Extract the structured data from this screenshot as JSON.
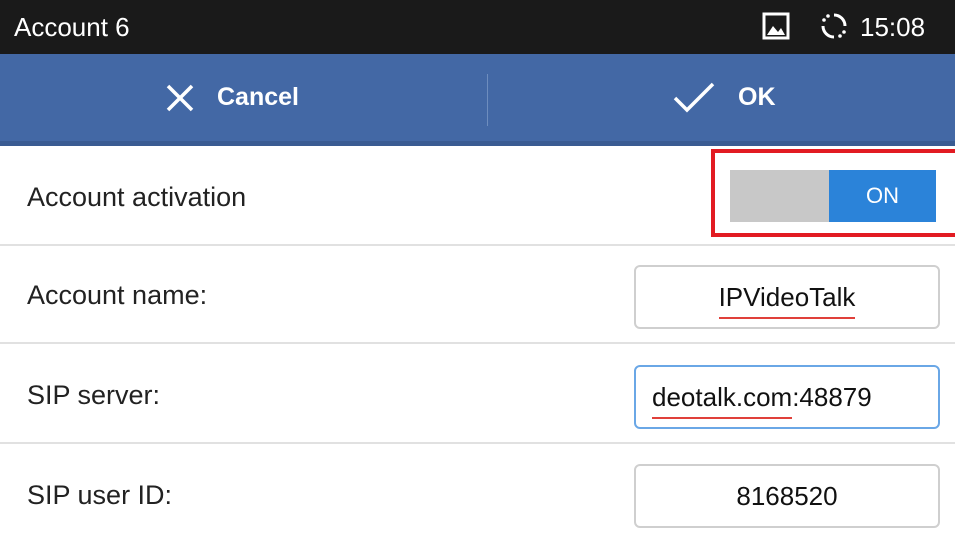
{
  "status_bar": {
    "title": "Account 6",
    "time": "15:08",
    "icons": [
      "picture-icon",
      "sync-icon"
    ]
  },
  "action_bar": {
    "cancel_label": "Cancel",
    "ok_label": "OK",
    "background_color": "#4368a5"
  },
  "settings": {
    "account_activation": {
      "label": "Account activation",
      "toggle_state": "ON",
      "accent_color": "#2b83d9"
    },
    "account_name": {
      "label": "Account name:",
      "value": "IPVideoTalk"
    },
    "sip_server": {
      "label": "SIP server:",
      "value_prefix": "deotalk.com",
      "value_suffix": ":48879"
    },
    "sip_user_id": {
      "label": "SIP user ID:",
      "value": "8168520"
    }
  },
  "highlight_color": "#e21b22"
}
